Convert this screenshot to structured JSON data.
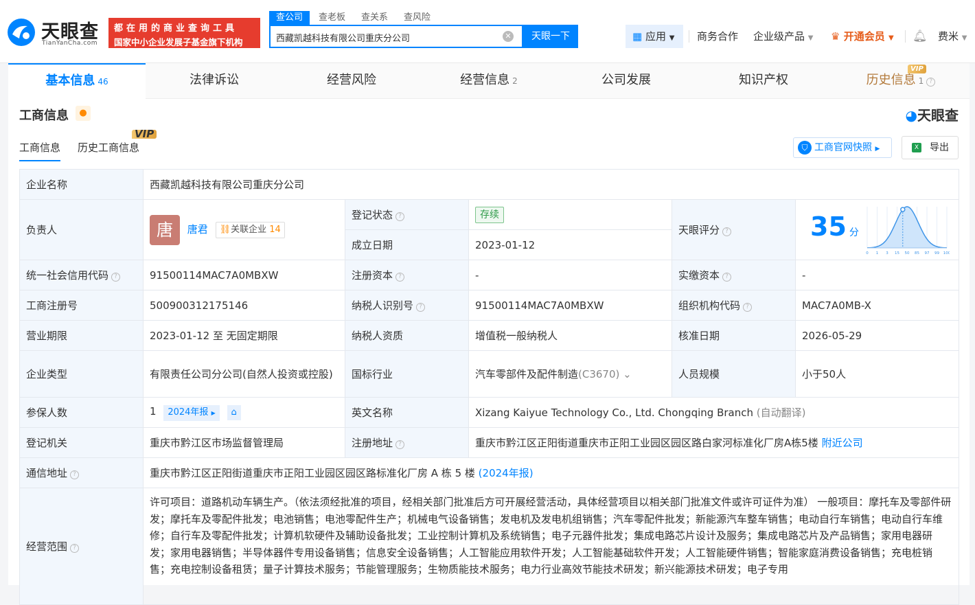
{
  "brand": {
    "name_cn": "天眼查",
    "name_en": "TianYanCha.com"
  },
  "promo": {
    "line1": "都在用的商业查询工具",
    "line2": "国家中小企业发展子基金旗下机构"
  },
  "search": {
    "tabs": [
      "查公司",
      "查老板",
      "查关系",
      "查风险"
    ],
    "value": "西藏凯越科技有限公司重庆分公司",
    "button": "天眼一下"
  },
  "nav": {
    "app": "应用",
    "biz": "商务合作",
    "enterprise": "企业级产品",
    "vip": "开通会员",
    "user": "费米"
  },
  "tabs": [
    {
      "label": "基本信息",
      "count": "46"
    },
    {
      "label": "法律诉讼",
      "count": ""
    },
    {
      "label": "经营风险",
      "count": ""
    },
    {
      "label": "经营信息",
      "count": "2"
    },
    {
      "label": "公司发展",
      "count": ""
    },
    {
      "label": "知识产权",
      "count": ""
    },
    {
      "label": "历史信息",
      "count": "1"
    }
  ],
  "vip_badge": "VIP",
  "section": {
    "title": "工商信息",
    "tyc_mark": "天眼查"
  },
  "subtabs": [
    "工商信息",
    "历史工商信息"
  ],
  "buttons": {
    "gs_snapshot": "工商官网快照",
    "export": "导出"
  },
  "info": {
    "company_name_k": "企业名称",
    "company_name_v": "西藏凯越科技有限公司重庆分公司",
    "leader_k": "负责人",
    "leader_avatar": "唐",
    "leader_name": "唐君",
    "related_label": "关联企业",
    "related_count": "14",
    "reg_status_k": "登记状态",
    "reg_status_v": "存续",
    "est_date_k": "成立日期",
    "est_date_v": "2023-01-12",
    "score_k": "天眼评分",
    "score_v": "35",
    "score_unit": "分",
    "credit_code_k": "统一社会信用代码",
    "credit_code_v": "91500114MAC7A0MBXW",
    "reg_capital_k": "注册资本",
    "reg_capital_v": "-",
    "paid_capital_k": "实缴资本",
    "paid_capital_v": "-",
    "reg_no_k": "工商注册号",
    "reg_no_v": "500900312175146",
    "taxpayer_id_k": "纳税人识别号",
    "taxpayer_id_v": "91500114MAC7A0MBXW",
    "org_code_k": "组织机构代码",
    "org_code_v": "MAC7A0MB-X",
    "term_k": "营业期限",
    "term_v": "2023-01-12 至 无固定期限",
    "taxpayer_qual_k": "纳税人资质",
    "taxpayer_qual_v": "增值税一般纳税人",
    "approve_date_k": "核准日期",
    "approve_date_v": "2026-05-29",
    "type_k": "企业类型",
    "type_v": "有限责任公司分公司(自然人投资或控股)",
    "industry_k": "国标行业",
    "industry_v": "汽车零部件及配件制造",
    "industry_code": "(C3670)",
    "staff_k": "人员规模",
    "staff_v": "小于50人",
    "insured_k": "参保人数",
    "insured_v": "1",
    "insured_report": "2024年报",
    "en_name_k": "英文名称",
    "en_name_v": "Xizang Kaiyue Technology Co., Ltd. Chongqing Branch",
    "en_name_note": "(自动翻译)",
    "authority_k": "登记机关",
    "authority_v": "重庆市黔江区市场监督管理局",
    "reg_addr_k": "注册地址",
    "reg_addr_v": "重庆市黔江区正阳街道重庆市正阳工业园区园区路白家河标准化厂房A栋5楼",
    "nearby": "附近公司",
    "mail_addr_k": "通信地址",
    "mail_addr_v": "重庆市黔江区正阳街道重庆市正阳工业园区园区路标准化厂房 A 栋 5 楼",
    "mail_addr_report": "(2024年报)",
    "scope_k": "经营范围",
    "scope_v": "许可项目：道路机动车辆生产。（依法须经批准的项目，经相关部门批准后方可开展经营活动，具体经营项目以相关部门批准文件或许可证件为准） 一般项目：摩托车及零部件研发；摩托车及零配件批发；电池销售；电池零配件生产；机械电气设备销售；发电机及发电机组销售；汽车零配件批发；新能源汽车整车销售；电动自行车销售；电动自行车维修；自行车及零配件批发；计算机软硬件及辅助设备批发；工业控制计算机及系统销售；电子元器件批发；集成电路芯片设计及服务；集成电路芯片及产品销售；家用电器研发；家用电器销售；半导体器件专用设备销售；信息安全设备销售；人工智能应用软件开发；人工智能基础软件开发；人工智能硬件销售；智能家庭消费设备销售；充电桩销售；充电控制设备租赁；量子计算技术服务；节能管理服务；生物质能技术服务；电力行业高效节能技术研发；新兴能源技术研发；电子专用"
  },
  "score_chart": {
    "x_ticks": [
      "0",
      "1",
      "3",
      "15",
      "50",
      "85",
      "97",
      "99",
      "100"
    ],
    "marker_value": 35
  },
  "colors": {
    "accent": "#0084ff",
    "promo": "#e63c2e",
    "status_green": "#2e9a48"
  }
}
